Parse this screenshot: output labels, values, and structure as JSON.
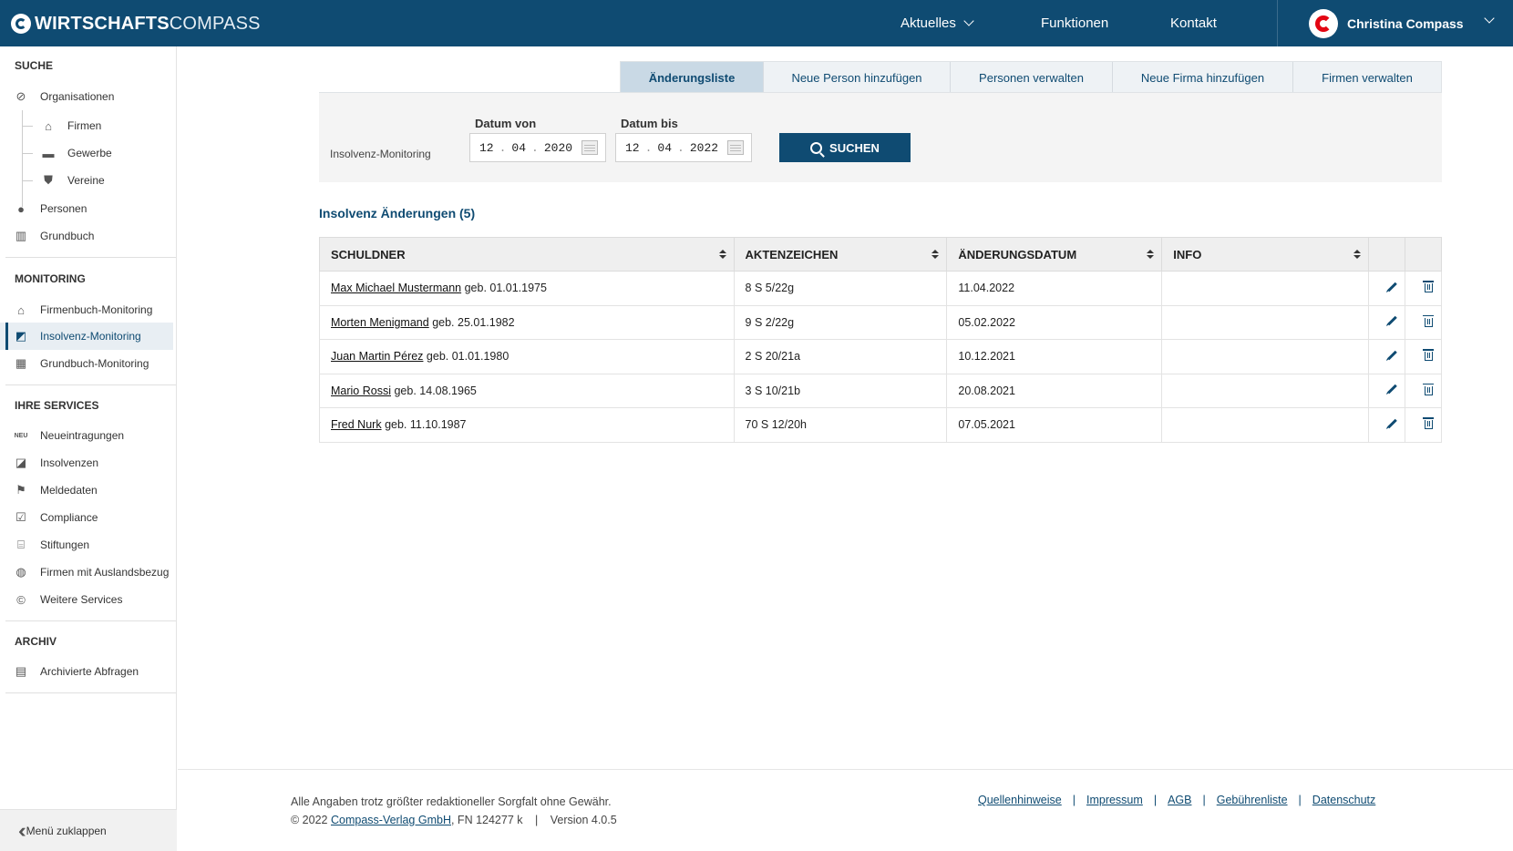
{
  "header": {
    "brand_bold": "WIRTSCHAFTS",
    "brand_light": "COMPASS",
    "nav": [
      {
        "label": "Aktuelles",
        "has_dropdown": true
      },
      {
        "label": "Funktionen"
      },
      {
        "label": "Kontakt"
      }
    ],
    "user_name": "Christina Compass"
  },
  "sidebar": {
    "sections": {
      "suche": "SUCHE",
      "monitoring": "MONITORING",
      "services": "IHRE SERVICES",
      "archiv": "ARCHIV"
    },
    "suche_items": [
      {
        "label": "Organisationen",
        "icon": "compass-icon"
      },
      {
        "label": "Firmen",
        "icon": "factory-icon"
      },
      {
        "label": "Gewerbe",
        "icon": "briefcase-icon"
      },
      {
        "label": "Vereine",
        "icon": "shield-icon"
      },
      {
        "label": "Personen",
        "icon": "person-icon"
      },
      {
        "label": "Grundbuch",
        "icon": "book-icon"
      }
    ],
    "monitoring_items": [
      {
        "label": "Firmenbuch-Monitoring",
        "icon": "factory-plus-icon"
      },
      {
        "label": "Insolvenz-Monitoring",
        "icon": "insolvency-plus-icon",
        "active": true
      },
      {
        "label": "Grundbuch-Monitoring",
        "icon": "building-plus-icon"
      }
    ],
    "service_items": [
      {
        "label": "Neueintragungen",
        "icon": "new-badge-icon",
        "icon_text": "NEU"
      },
      {
        "label": "Insolvenzen",
        "icon": "insolvency-icon"
      },
      {
        "label": "Meldedaten",
        "icon": "flag-icon"
      },
      {
        "label": "Compliance",
        "icon": "checkbox-icon"
      },
      {
        "label": "Stiftungen",
        "icon": "bank-icon"
      },
      {
        "label": "Firmen mit Auslandsbezug",
        "icon": "globe-icon"
      },
      {
        "label": "Weitere Services",
        "icon": "compass-c-icon"
      }
    ],
    "archiv_items": [
      {
        "label": "Archivierte Abfragen",
        "icon": "archive-box-icon"
      }
    ],
    "collapse_label": "Menü zuklappen"
  },
  "tabs": [
    {
      "label": "Änderungsliste",
      "active": true
    },
    {
      "label": "Neue Person hinzufügen"
    },
    {
      "label": "Personen verwalten"
    },
    {
      "label": "Neue Firma hinzufügen"
    },
    {
      "label": "Firmen verwalten"
    }
  ],
  "filter": {
    "label": "Insolvenz-Monitoring",
    "date_from_label": "Datum von",
    "date_from": {
      "day": "12",
      "month": "04",
      "year": "2020"
    },
    "date_to_label": "Datum bis",
    "date_to": {
      "day": "12",
      "month": "04",
      "year": "2022"
    },
    "search_label": "SUCHEN"
  },
  "list_title": "Insolvenz Änderungen (5)",
  "table": {
    "headers": [
      "SCHULDNER",
      "AKTENZEICHEN",
      "ÄNDERUNGSDATUM",
      "INFO"
    ],
    "rows": [
      {
        "name": "Max Michael Mustermann",
        "birth": "geb. 01.01.1975",
        "az": "8 S 5/22g",
        "date": "11.04.2022",
        "info": ""
      },
      {
        "name": "Morten Menigmand",
        "birth": "geb. 25.01.1982",
        "az": "9 S 2/22g",
        "date": "05.02.2022",
        "info": ""
      },
      {
        "name": "Juan Martin Pérez",
        "birth": "geb. 01.01.1980",
        "az": "2 S 20/21a",
        "date": "10.12.2021",
        "info": ""
      },
      {
        "name": "Mario Rossi",
        "birth": "geb. 14.08.1965",
        "az": "3 S 10/21b",
        "date": "20.08.2021",
        "info": ""
      },
      {
        "name": "Fred Nurk",
        "birth": "geb. 11.10.1987",
        "az": "70 S 12/20h",
        "date": "07.05.2021",
        "info": ""
      }
    ]
  },
  "footer": {
    "disclaimer": "Alle Angaben trotz größter redaktioneller Sorgfalt ohne Gewähr.",
    "copyright_prefix": "© 2022",
    "company_link": "Compass-Verlag GmbH",
    "fn": ", FN 124277 k",
    "version_sep": "|",
    "version": "Version 4.0.5",
    "links": [
      "Quellenhinweise",
      "Impressum",
      "AGB",
      "Gebührenliste",
      "Datenschutz"
    ],
    "link_sep": "|"
  },
  "colors": {
    "primary": "#0f4b72",
    "accent_red": "#e30613"
  }
}
